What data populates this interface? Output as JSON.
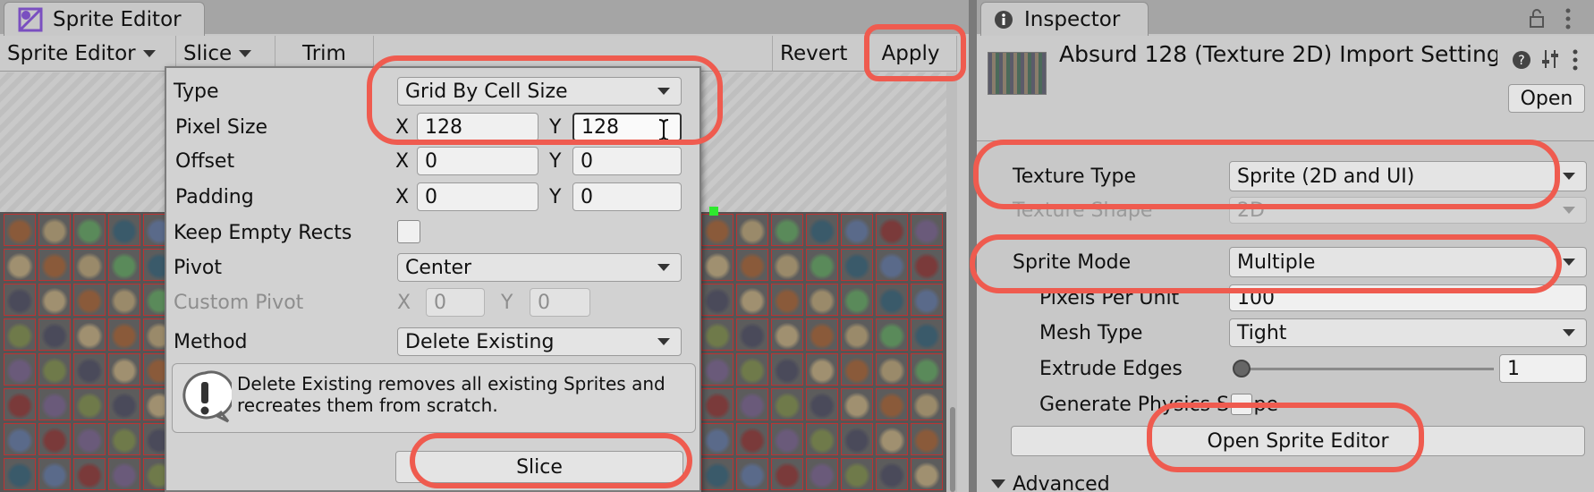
{
  "sprite_editor": {
    "tab_title": "Sprite Editor",
    "toolbar": {
      "mode_label": "Sprite Editor",
      "slice_label": "Slice",
      "trim_label": "Trim",
      "revert_label": "Revert",
      "apply_label": "Apply"
    }
  },
  "slice_popup": {
    "type_label": "Type",
    "type_value": "Grid By Cell Size",
    "pixel_size_label": "Pixel Size",
    "pixel_x": "128",
    "pixel_y": "128",
    "offset_label": "Offset",
    "offset_x": "0",
    "offset_y": "0",
    "padding_label": "Padding",
    "padding_x": "0",
    "padding_y": "0",
    "keep_empty_label": "Keep Empty Rects",
    "pivot_label": "Pivot",
    "pivot_value": "Center",
    "custom_pivot_label": "Custom Pivot",
    "custom_pivot_x": "0",
    "custom_pivot_y": "0",
    "method_label": "Method",
    "method_value": "Delete Existing",
    "info_text": "Delete Existing removes all existing Sprites and recreates them from scratch.",
    "slice_button": "Slice",
    "axis_x": "X",
    "axis_y": "Y"
  },
  "inspector": {
    "tab_title": "Inspector",
    "asset_title": "Absurd 128 (Texture 2D) Import Settings",
    "open_button": "Open",
    "texture_type_label": "Texture Type",
    "texture_type_value": "Sprite (2D and UI)",
    "texture_shape_label": "Texture Shape",
    "texture_shape_value": "2D",
    "sprite_mode_label": "Sprite Mode",
    "sprite_mode_value": "Multiple",
    "ppu_label": "Pixels Per Unit",
    "ppu_value": "100",
    "mesh_type_label": "Mesh Type",
    "mesh_type_value": "Tight",
    "extrude_label": "Extrude Edges",
    "extrude_value": "1",
    "gen_physics_label": "Generate Physics Shape",
    "open_sprite_editor_button": "Open Sprite Editor",
    "advanced_label": "Advanced"
  },
  "colors": {
    "highlight": "#ef5b4f",
    "panel": "#c8c8c8",
    "tabbar": "#a5a5a5"
  }
}
